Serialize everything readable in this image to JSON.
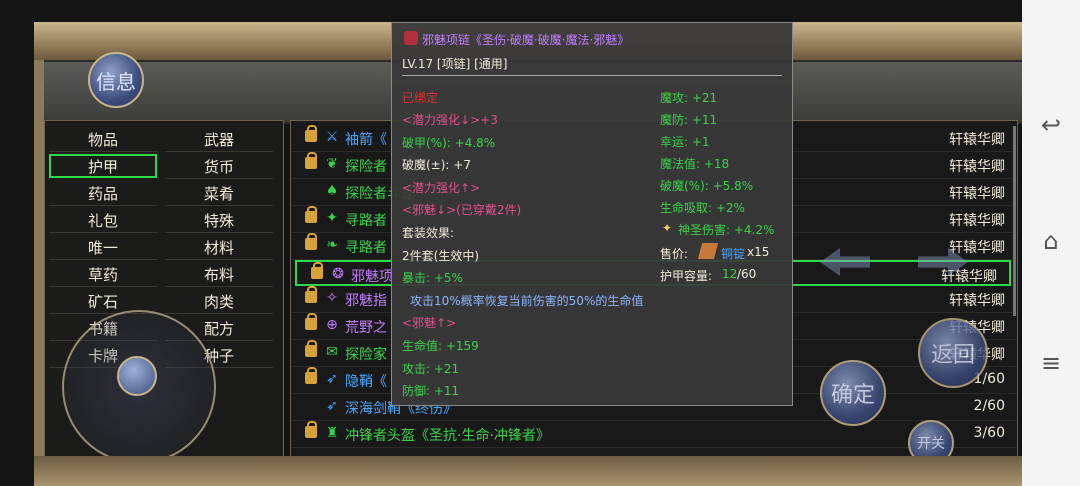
{
  "buttons": {
    "info": "信息",
    "confirm": "确定",
    "back": "返回",
    "switch": "开关"
  },
  "categories": [
    {
      "label": "物品"
    },
    {
      "label": "武器"
    },
    {
      "label": "护甲"
    },
    {
      "label": "货币"
    },
    {
      "label": "药品"
    },
    {
      "label": "菜肴"
    },
    {
      "label": "礼包"
    },
    {
      "label": "特殊"
    },
    {
      "label": "唯一"
    },
    {
      "label": "材料"
    },
    {
      "label": "草药"
    },
    {
      "label": "布料"
    },
    {
      "label": "矿石"
    },
    {
      "label": "肉类"
    },
    {
      "label": "书籍"
    },
    {
      "label": "配方"
    },
    {
      "label": "卡牌"
    },
    {
      "label": "种子"
    }
  ],
  "selected_category": "护甲",
  "items": [
    {
      "name": "袖箭《",
      "owner": "轩辕华卿",
      "icon": "crossed-swords-icon",
      "glyph": "⚔",
      "color": "#4aa8ff",
      "locked": true
    },
    {
      "name": "探险者",
      "owner": "轩辕华卿",
      "icon": "wings-icon",
      "glyph": "❦",
      "color": "#3ad24a",
      "locked": true
    },
    {
      "name": "探险者斗篷",
      "owner": "轩辕华卿",
      "icon": "cape-icon",
      "glyph": "♠",
      "color": "#3ad24a",
      "locked": false
    },
    {
      "name": "寻路者",
      "owner": "轩辕华卿",
      "icon": "boot-icon",
      "glyph": "✦",
      "color": "#3ad24a",
      "locked": true
    },
    {
      "name": "寻路者",
      "owner": "轩辕华卿",
      "icon": "leaf-icon",
      "glyph": "❧",
      "color": "#3ad24a",
      "locked": true
    },
    {
      "name": "邪魅项",
      "owner": "轩辕华卿",
      "icon": "necklace-icon",
      "glyph": "❂",
      "color": "#c27cff",
      "locked": true
    },
    {
      "name": "邪魅指",
      "owner": "轩辕华卿",
      "icon": "ring-icon",
      "glyph": "✧",
      "color": "#c27cff",
      "locked": true
    },
    {
      "name": "荒野之",
      "owner": "轩辕华卿",
      "icon": "shield-icon",
      "glyph": "⊕",
      "color": "#c27cff",
      "locked": true
    },
    {
      "name": "探险家",
      "owner": "轩辕华卿",
      "icon": "scroll-icon",
      "glyph": "✉",
      "color": "#3ad24a",
      "locked": true
    },
    {
      "name": "隐鞘《",
      "owner": "1/60",
      "icon": "dagger-icon",
      "glyph": "➶",
      "color": "#4aa8ff",
      "locked": true
    },
    {
      "name": "深海剑鞘《终伤》",
      "owner": "2/60",
      "icon": "sheath-icon",
      "glyph": "➶",
      "color": "#4aa8ff",
      "locked": false
    },
    {
      "name": "冲锋者头盔《圣抗·生命·冲锋者》",
      "owner": "3/60",
      "icon": "helmet-icon",
      "glyph": "♜",
      "color": "#3ad24a",
      "locked": true
    }
  ],
  "selected_item_index": 5,
  "tooltip": {
    "title": "邪魅项链《圣伤·破魔·破魔·魔法·邪魅》",
    "level": "LV.17  [项链]  [通用]",
    "bound": "已绑定",
    "left_lines": [
      {
        "text": "<潜力强化↓>+3",
        "color": "#e0508a"
      },
      {
        "text": "破甲(%): +4.8%",
        "color": "#3ad24a"
      },
      {
        "text": "破魔(±): +7",
        "color": "#f0ead8"
      },
      {
        "text": "<潜力强化↑>",
        "color": "#e0508a"
      },
      {
        "text": "<邪魅↓>(已穿戴2件)",
        "color": "#e0508a"
      },
      {
        "text": "套装效果:",
        "color": "#f0ead8"
      },
      {
        "text": "2件套(生效中)",
        "color": "#f0ead8"
      },
      {
        "text": "暴击: +5%",
        "color": "#3ad24a"
      },
      {
        "text": "攻击10%概率恢复当前伤害的50%的生命值",
        "color": "#8cb4ff"
      },
      {
        "text": "<邪魅↑>",
        "color": "#e0508a"
      },
      {
        "text": "生命值: +159",
        "color": "#3ad24a"
      },
      {
        "text": "攻击: +21",
        "color": "#3ad24a"
      },
      {
        "text": "防御: +11",
        "color": "#3ad24a"
      }
    ],
    "right_lines": [
      {
        "text": "魔攻: +21",
        "color": "#3ad24a"
      },
      {
        "text": "魔防: +11",
        "color": "#3ad24a"
      },
      {
        "text": "幸运: +1",
        "color": "#3ad24a"
      },
      {
        "text": "魔法值: +18",
        "color": "#3ad24a"
      },
      {
        "text": "破魔(%): +5.8%",
        "color": "#3ad24a"
      },
      {
        "text": "生命吸取: +2%",
        "color": "#3ad24a"
      },
      {
        "text": "神圣伤害: +4.2%",
        "color": "#3ad24a"
      }
    ],
    "price_label": "售价:",
    "price_currency": "铜锭",
    "price_amount": "x15",
    "capacity_label": "护甲容量:",
    "capacity_used": "12",
    "capacity_total": "/60"
  }
}
